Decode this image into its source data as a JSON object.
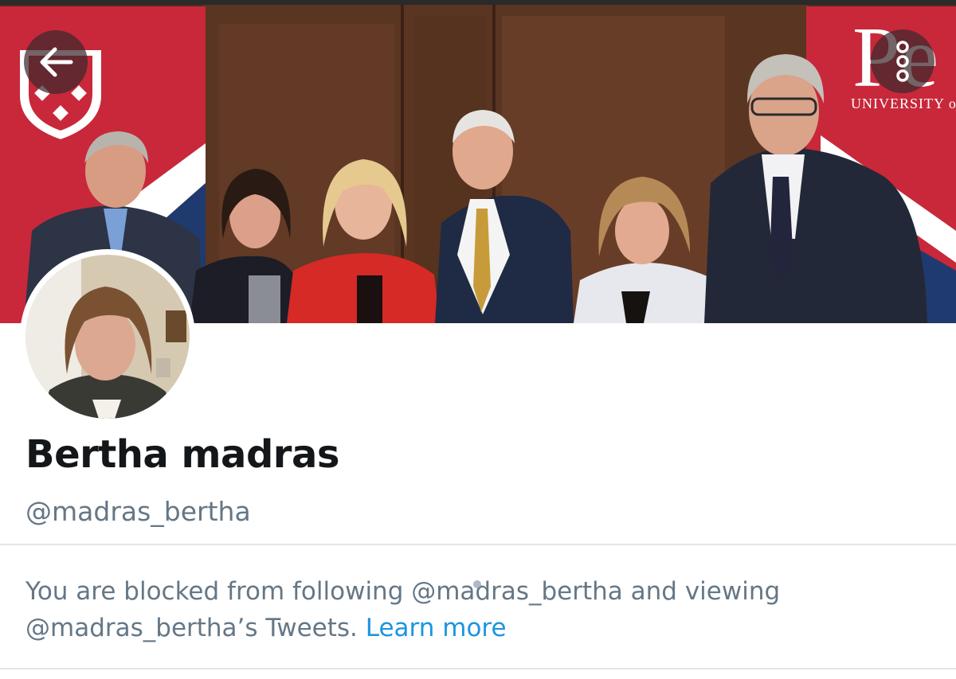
{
  "banner": {
    "description_icon": "cover-photo",
    "back_icon": "arrow-left-icon",
    "more_icon": "more-vertical-icon",
    "sign_text_large": "Pe",
    "sign_text_small": "UNIVERSITY o"
  },
  "profile": {
    "display_name": "Bertha madras",
    "handle": "@madras_bertha"
  },
  "blocked": {
    "message": "You are blocked from following @madras_bertha and viewing @madras_bertha’s Tweets.",
    "learn_more": "Learn more"
  },
  "colors": {
    "text_primary": "#14171a",
    "text_secondary": "#657786",
    "link": "#1b95e0",
    "divider": "#e1e6ea",
    "banner_red": "#c8283a"
  }
}
